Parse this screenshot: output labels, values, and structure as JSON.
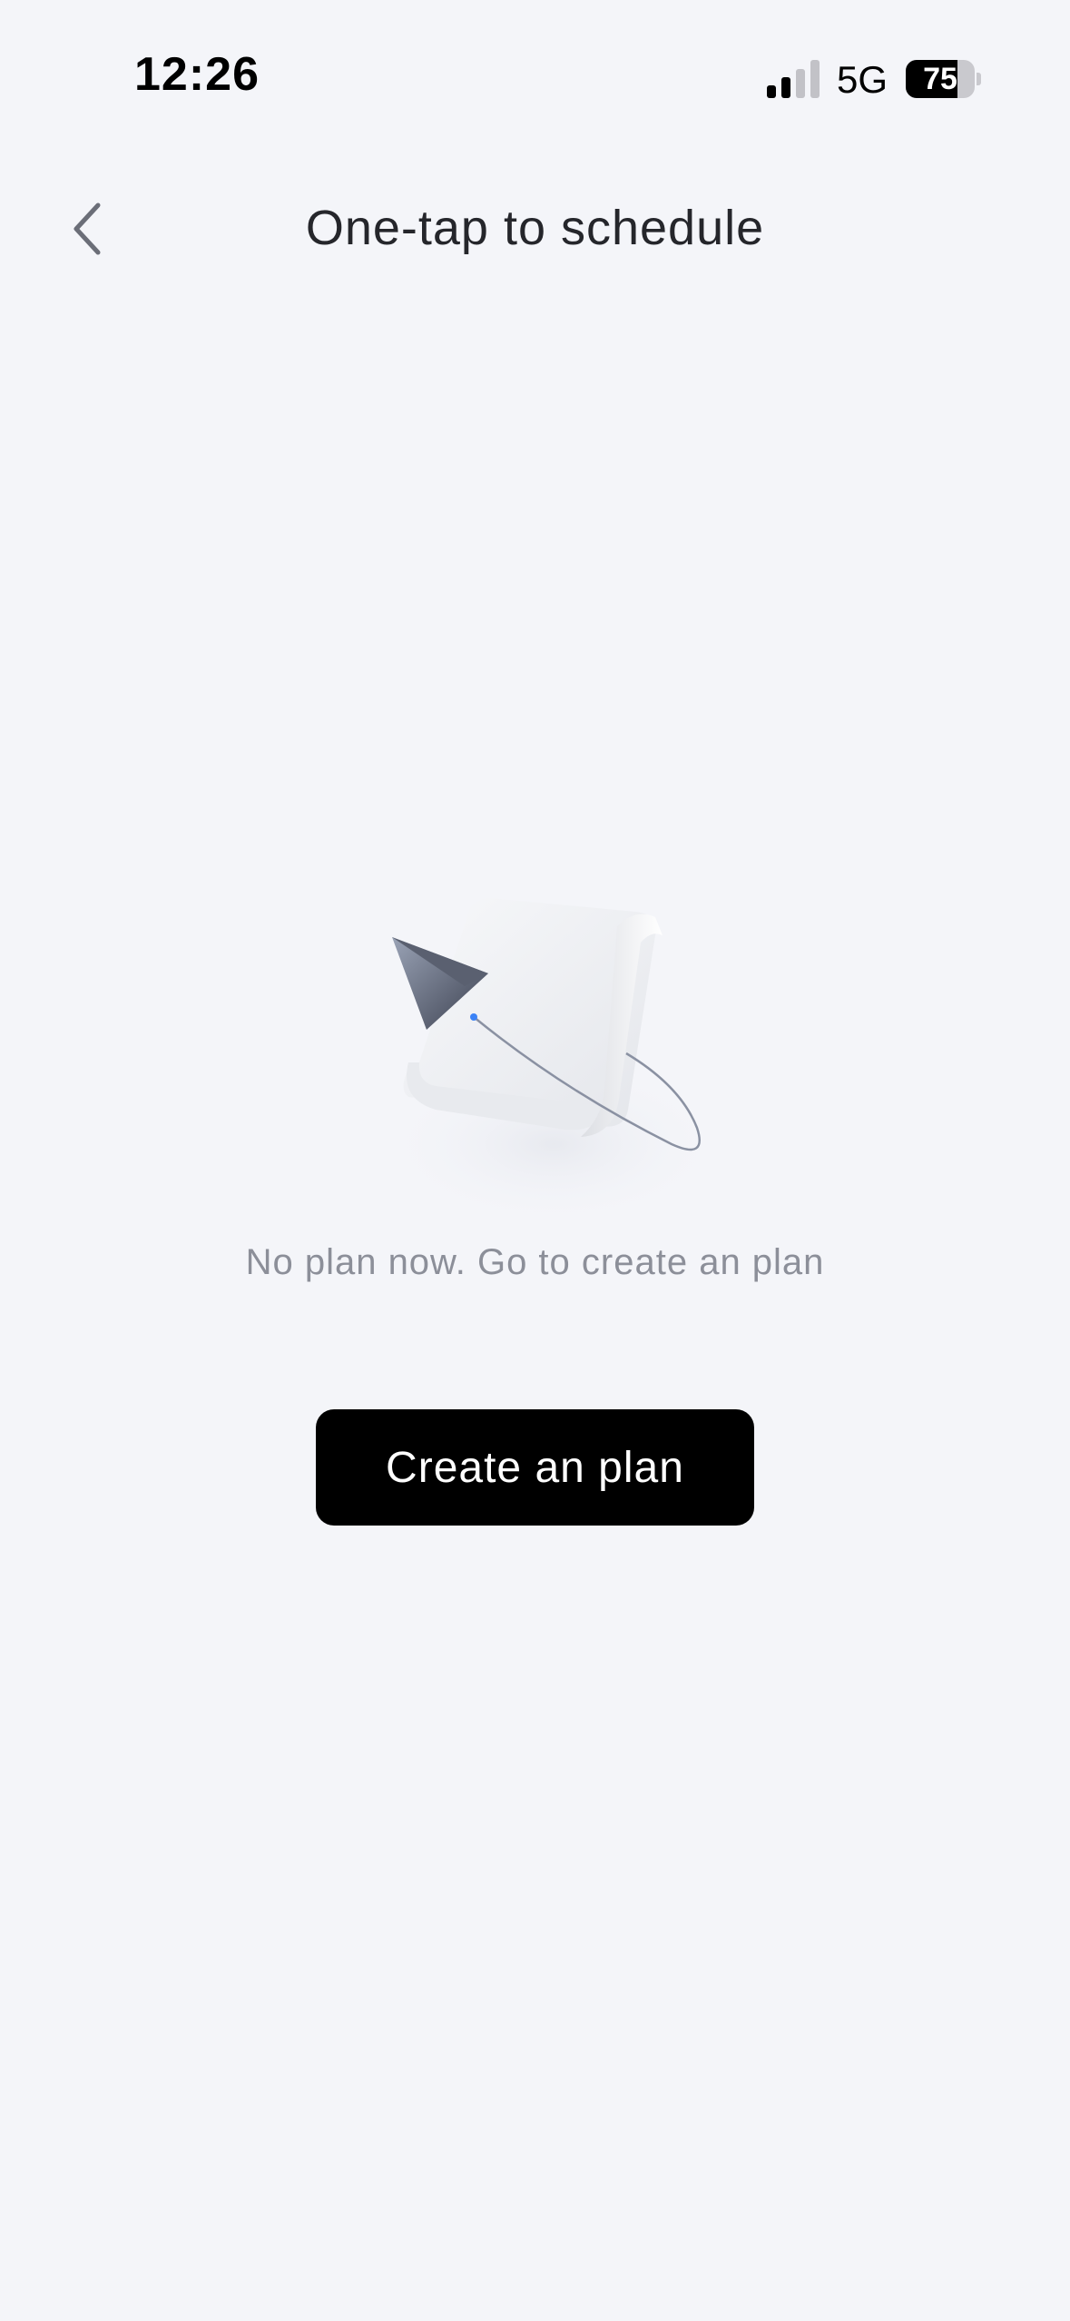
{
  "status_bar": {
    "time": "12:26",
    "network": "5G",
    "battery_level": "75",
    "battery_fraction": 0.75,
    "signal_bars_active": 2,
    "signal_bars_total": 4,
    "icons": [
      "signal-icon",
      "battery-icon"
    ]
  },
  "header": {
    "back_icon": "chevron-left-icon",
    "title": "One-tap to schedule"
  },
  "empty_state": {
    "illustration": "paper-plane-scroll-illustration",
    "message": "No plan now. Go to create an plan"
  },
  "actions": {
    "create_label": "Create an plan"
  },
  "colors": {
    "background": "#f4f5f9",
    "title_text": "#25262b",
    "muted_text": "#8c8f99",
    "button_bg": "#000000",
    "button_text": "#ffffff"
  }
}
